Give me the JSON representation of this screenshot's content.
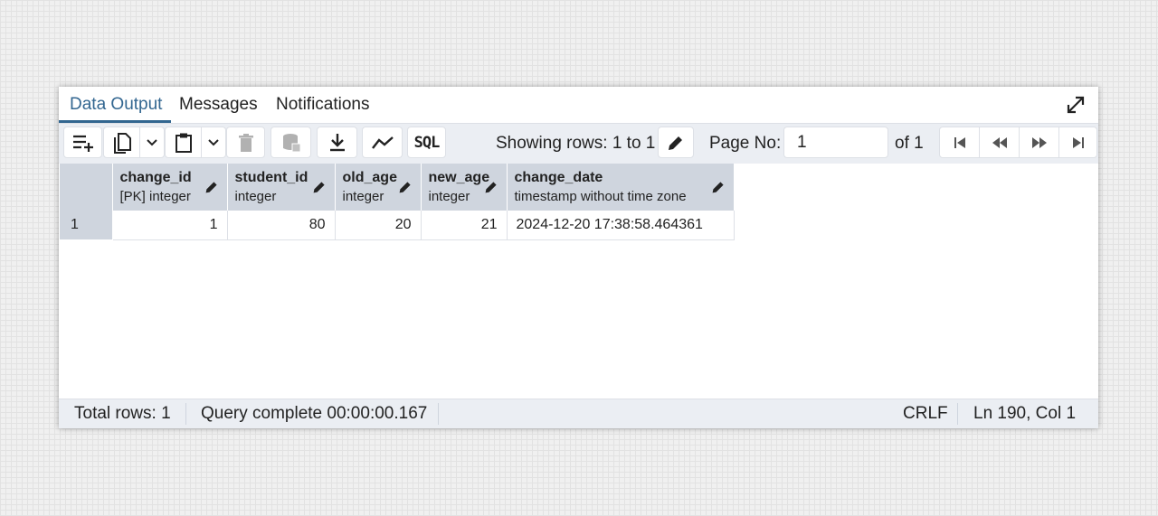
{
  "tabs": [
    {
      "label": "Data Output",
      "active": true
    },
    {
      "label": "Messages",
      "active": false
    },
    {
      "label": "Notifications",
      "active": false
    }
  ],
  "toolbar": {
    "showing_rows": "Showing rows: 1 to 1",
    "page_no_label": "Page No:",
    "page_value": "1",
    "of_pages": "of 1",
    "sql_label": "SQL"
  },
  "grid": {
    "columns": [
      {
        "name": "change_id",
        "type": "[PK] integer"
      },
      {
        "name": "student_id",
        "type": "integer"
      },
      {
        "name": "old_age",
        "type": "integer"
      },
      {
        "name": "new_age",
        "type": "integer"
      },
      {
        "name": "change_date",
        "type": "timestamp without time zone"
      }
    ],
    "rows": [
      {
        "index": "1",
        "cells": [
          "1",
          "80",
          "20",
          "21",
          "2024-12-20 17:38:58.464361"
        ]
      }
    ]
  },
  "status": {
    "total_rows": "Total rows: 1",
    "query": "Query complete 00:00:00.167",
    "line_ending": "CRLF",
    "cursor": "Ln 190, Col 1"
  },
  "colors": {
    "accent": "#326690",
    "header_bg": "#cfd5de",
    "toolbar_bg": "#ebeef3"
  }
}
